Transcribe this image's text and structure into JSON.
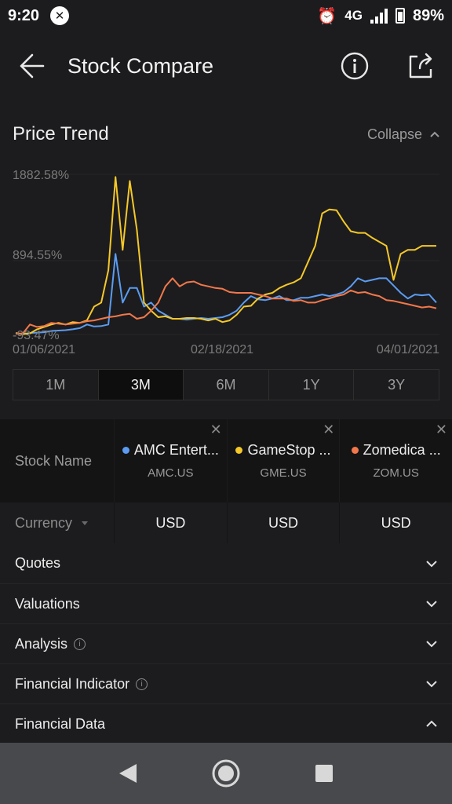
{
  "status_bar": {
    "time": "9:20",
    "network": "4G",
    "battery": "89%"
  },
  "header": {
    "title": "Stock Compare",
    "back_icon": "arrow-left-icon",
    "info_icon": "info-circle-icon",
    "share_icon": "share-icon"
  },
  "price_trend": {
    "title": "Price Trend",
    "collapse_label": "Collapse"
  },
  "chart_data": {
    "type": "line",
    "y_ticks": [
      "1882.58%",
      "894.55%",
      "-93.47%"
    ],
    "x_ticks": [
      "01/06/2021",
      "02/18/2021",
      "04/01/2021"
    ],
    "ylim": [
      -93.47,
      1882.58
    ],
    "x_count": 60,
    "series": [
      {
        "name": "AMC Entert...",
        "color": "#5b9cf2",
        "values": [
          -80,
          -85,
          -75,
          -70,
          -65,
          -50,
          -45,
          -40,
          -30,
          -15,
          30,
          5,
          10,
          30,
          900,
          300,
          480,
          480,
          250,
          300,
          200,
          150,
          100,
          100,
          90,
          100,
          110,
          100,
          110,
          120,
          150,
          200,
          300,
          380,
          340,
          330,
          350,
          380,
          330,
          330,
          360,
          360,
          380,
          400,
          380,
          400,
          430,
          500,
          600,
          560,
          580,
          600,
          600,
          510,
          420,
          350,
          400,
          390,
          400,
          300
        ]
      },
      {
        "name": "GameStop ...",
        "color": "#f5c829",
        "values": [
          -75,
          -90,
          -80,
          -30,
          0,
          30,
          50,
          30,
          60,
          50,
          80,
          250,
          300,
          700,
          1850,
          950,
          1800,
          1200,
          300,
          200,
          120,
          130,
          100,
          100,
          110,
          110,
          100,
          80,
          100,
          60,
          80,
          150,
          250,
          260,
          350,
          400,
          420,
          480,
          520,
          550,
          600,
          800,
          1000,
          1400,
          1450,
          1440,
          1300,
          1180,
          1160,
          1160,
          1100,
          1050,
          1000,
          580,
          900,
          950,
          950,
          1000,
          1000,
          1000
        ]
      },
      {
        "name": "Zomedica ...",
        "color": "#f2784b",
        "values": [
          -85,
          -80,
          30,
          0,
          10,
          50,
          40,
          30,
          40,
          50,
          70,
          80,
          100,
          120,
          130,
          150,
          160,
          100,
          120,
          200,
          300,
          500,
          600,
          500,
          550,
          560,
          520,
          500,
          480,
          470,
          430,
          420,
          420,
          420,
          400,
          380,
          350,
          350,
          350,
          320,
          330,
          300,
          300,
          330,
          350,
          380,
          400,
          450,
          420,
          430,
          400,
          380,
          330,
          320,
          300,
          280,
          260,
          240,
          250,
          230
        ]
      }
    ]
  },
  "ranges": {
    "items": [
      "1M",
      "3M",
      "6M",
      "1Y",
      "3Y"
    ],
    "active": "3M"
  },
  "compare": {
    "stock_name_label": "Stock Name",
    "stocks": [
      {
        "name": "AMC Entert...",
        "ticker": "AMC.US",
        "color": "#5b9cf2",
        "currency": "USD"
      },
      {
        "name": "GameStop ...",
        "ticker": "GME.US",
        "color": "#f5c829",
        "currency": "USD"
      },
      {
        "name": "Zomedica ...",
        "ticker": "ZOM.US",
        "color": "#f2784b",
        "currency": "USD"
      }
    ],
    "currency_label": "Currency"
  },
  "sections": [
    {
      "label": "Quotes",
      "info": false,
      "expanded": false
    },
    {
      "label": "Valuations",
      "info": false,
      "expanded": false
    },
    {
      "label": "Analysis",
      "info": true,
      "expanded": false
    },
    {
      "label": "Financial Indicator",
      "info": true,
      "expanded": false
    },
    {
      "label": "Financial Data",
      "info": false,
      "expanded": true
    }
  ],
  "nav": {
    "back_icon": "nav-back-icon",
    "home_icon": "nav-home-icon",
    "recents_icon": "nav-recents-icon"
  }
}
